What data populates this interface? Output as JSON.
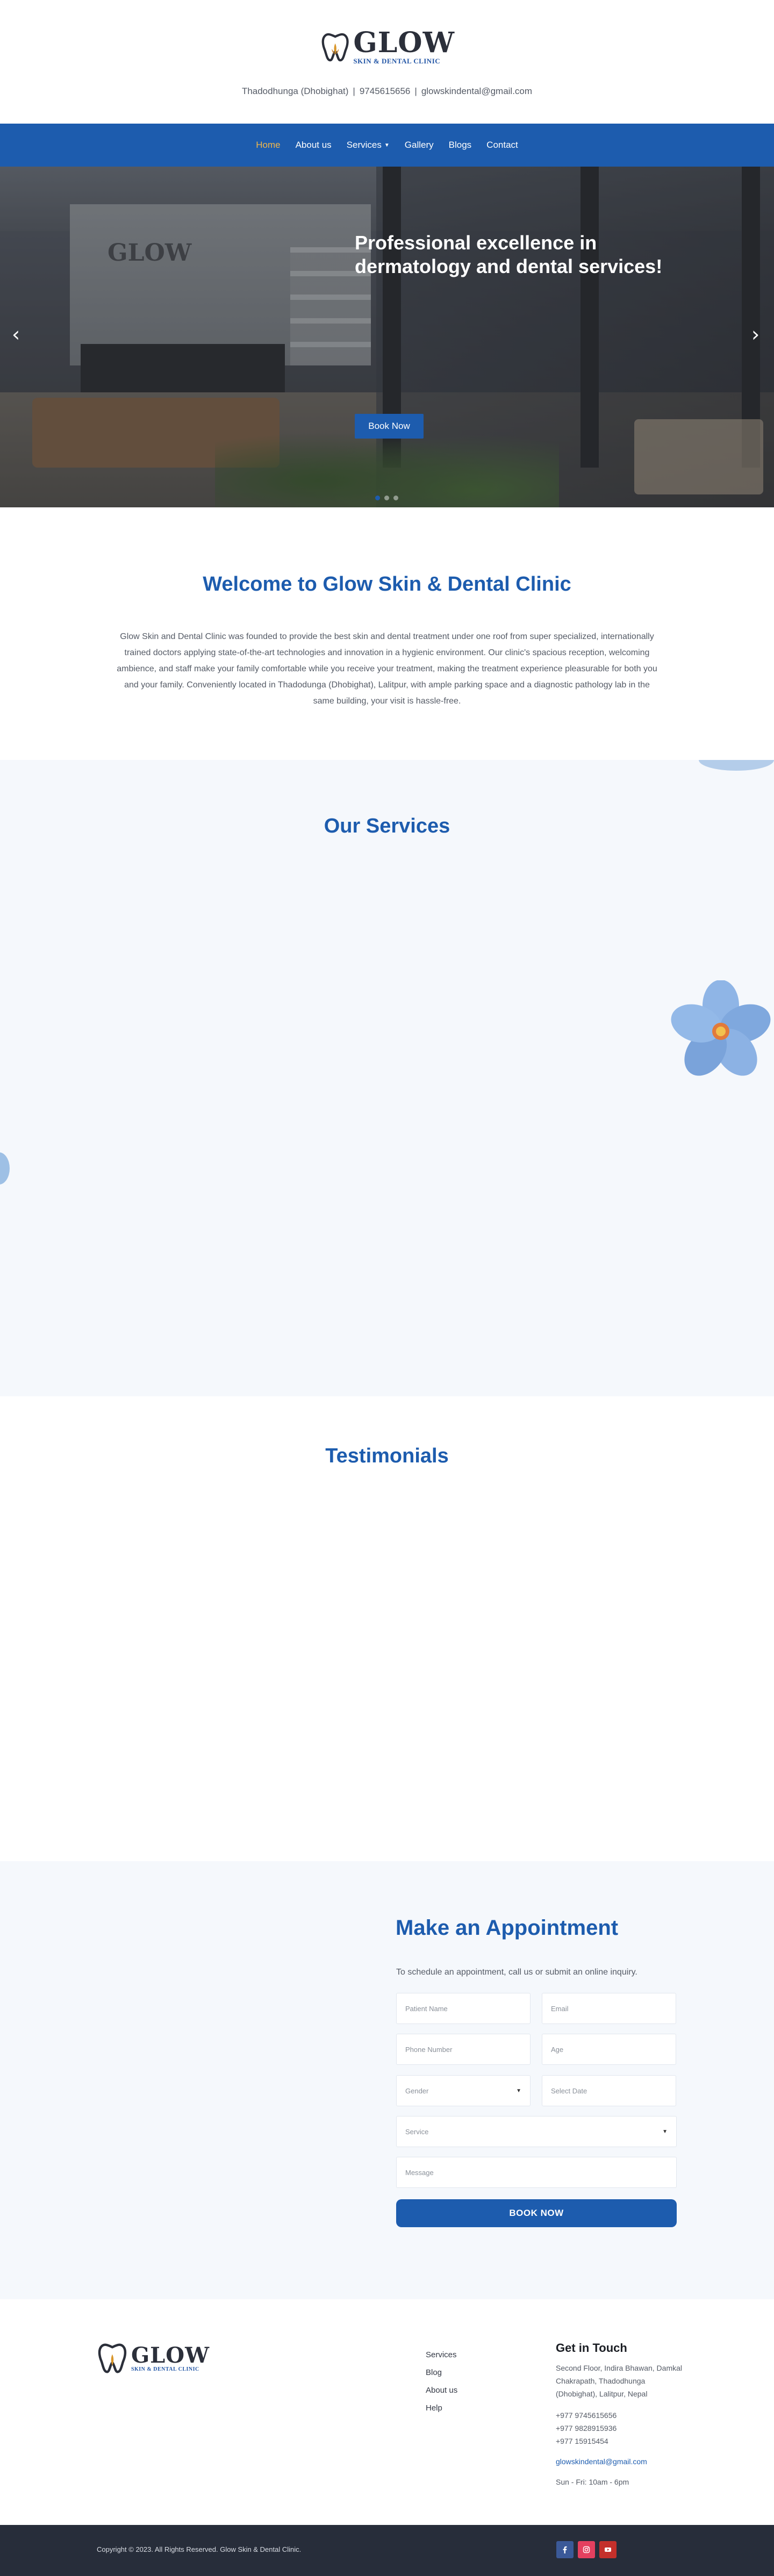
{
  "brand": {
    "name": "GLOW",
    "tagline": "SKIN & DENTAL CLINIC"
  },
  "contact": {
    "address": "Thadodhunga (Dhobighat)",
    "phone": "9745615656",
    "email": "glowskindental@gmail.com",
    "separator": "|"
  },
  "nav": {
    "items": [
      {
        "label": "Home"
      },
      {
        "label": "About us"
      },
      {
        "label": "Services",
        "has_dropdown": true
      },
      {
        "label": "Gallery"
      },
      {
        "label": "Blogs"
      },
      {
        "label": "Contact"
      }
    ],
    "active": "Home"
  },
  "hero": {
    "heading": "Professional excellence in dermatology and dental services!",
    "button": "Book Now",
    "prev_icon": "chevron-left-icon",
    "next_icon": "chevron-right-icon",
    "slides_count": 3,
    "active_slide": 1
  },
  "welcome": {
    "title": "Welcome to Glow Skin & Dental Clinic",
    "body": "Glow Skin and Dental Clinic was founded to provide the best skin and dental treatment under one roof from super specialized, internationally trained doctors applying state-of-the-art technologies and innovation in a hygienic environment. Our clinic's spacious reception, welcoming ambience, and staff make your family comfortable while you receive your treatment, making the treatment experience pleasurable for both you and your family. Conveniently located in Thadodunga (Dhobighat), Lalitpur, with ample parking space and a diagnostic pathology lab in the same building, your visit is hassle-free."
  },
  "services": {
    "title": "Our Services"
  },
  "testimonials": {
    "title": "Testimonials"
  },
  "appointment": {
    "title": "Make an Appointment",
    "subtitle": "To schedule an appointment, call us or submit an online inquiry.",
    "fields": {
      "patient_name": "Patient Name",
      "email": "Email",
      "phone": "Phone Number",
      "age": "Age",
      "gender": "Gender",
      "date": "Select Date",
      "service": "Service",
      "message": "Message"
    },
    "submit": "BOOK NOW"
  },
  "footer": {
    "links": [
      "Services",
      "Blog",
      "About us",
      "Help"
    ],
    "get_in_touch": {
      "title": "Get in Touch",
      "address": "Second Floor, Indira Bhawan, Damkal Chakrapath, Thadodhunga (Dhobighat), Lalitpur, Nepal",
      "phones": [
        "+977 9745615656",
        "+977 9828915936",
        "+977 15915454"
      ],
      "email": "glowskindental@gmail.com",
      "hours": "Sun - Fri: 10am - 6pm"
    },
    "copyright": "Copyright © 2023. All Rights Reserved. Glow Skin & Dental Clinic.",
    "socials": [
      {
        "name": "facebook-icon",
        "color": "#3b5998"
      },
      {
        "name": "instagram-icon",
        "color": "#e4405f"
      },
      {
        "name": "youtube-icon",
        "color": "#c4302b"
      }
    ]
  },
  "colors": {
    "primary": "#1d5cae",
    "nav_active": "#f2b84b",
    "section_bg": "#f5f8fc",
    "bottom_bar": "#272d3a"
  }
}
